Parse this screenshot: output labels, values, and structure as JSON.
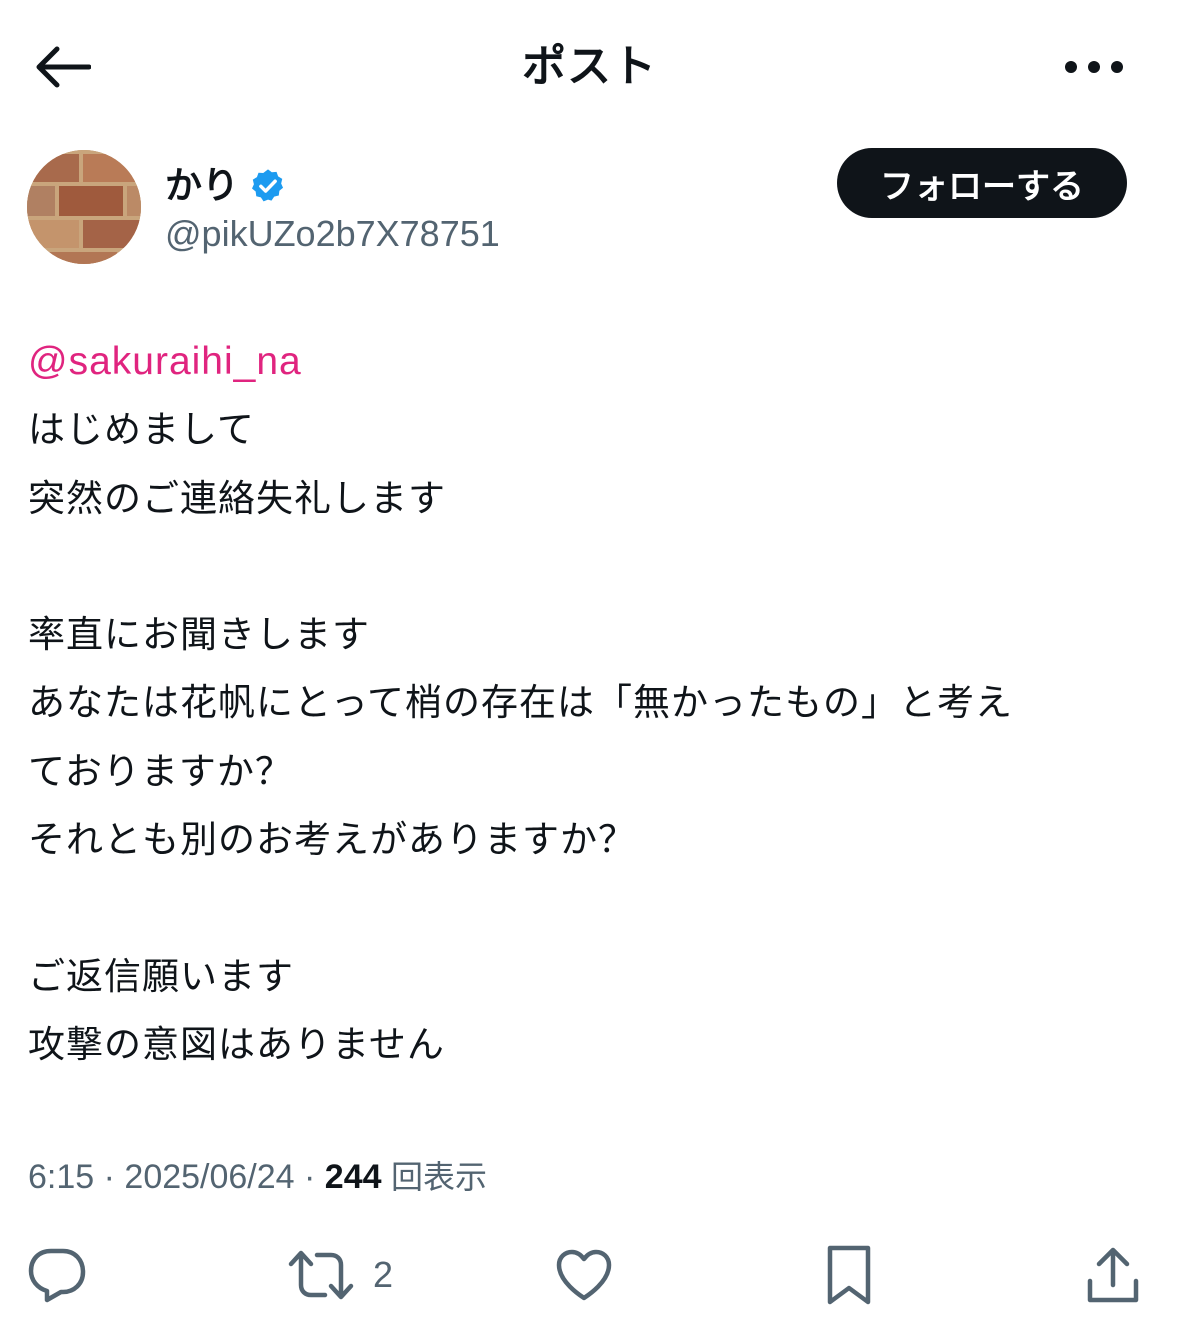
{
  "header": {
    "title": "ポスト",
    "back_icon": "arrow-left-icon",
    "more_icon": "more-horizontal-icon"
  },
  "author": {
    "display_name": "かり",
    "handle": "@pikUZo2b7X78751",
    "verified": true,
    "verified_color": "#1d9bf0",
    "follow_label": "フォローする"
  },
  "post": {
    "mention": "@sakuraihi_na",
    "lines": [
      "はじめまして",
      "突然のご連絡失礼します",
      "",
      "率直にお聞きします",
      "あなたは花帆にとって梢の存在は「無かったもの」と考え",
      "ておりますか？",
      "それとも別のお考えがありますか？",
      "",
      "ご返信願います",
      "攻撃の意図はありません"
    ]
  },
  "meta": {
    "time": "6:15",
    "separator": " · ",
    "date": "2025/06/24",
    "views": "244",
    "views_label": "回表示"
  },
  "actions": {
    "reply_icon": "reply-icon",
    "repost_icon": "repost-icon",
    "repost_count": "2",
    "like_icon": "heart-icon",
    "bookmark_icon": "bookmark-icon",
    "share_icon": "share-icon"
  },
  "colors": {
    "text": "#0f1419",
    "secondary": "#536471",
    "mention": "#e0247f",
    "button_bg": "#0f1419"
  }
}
